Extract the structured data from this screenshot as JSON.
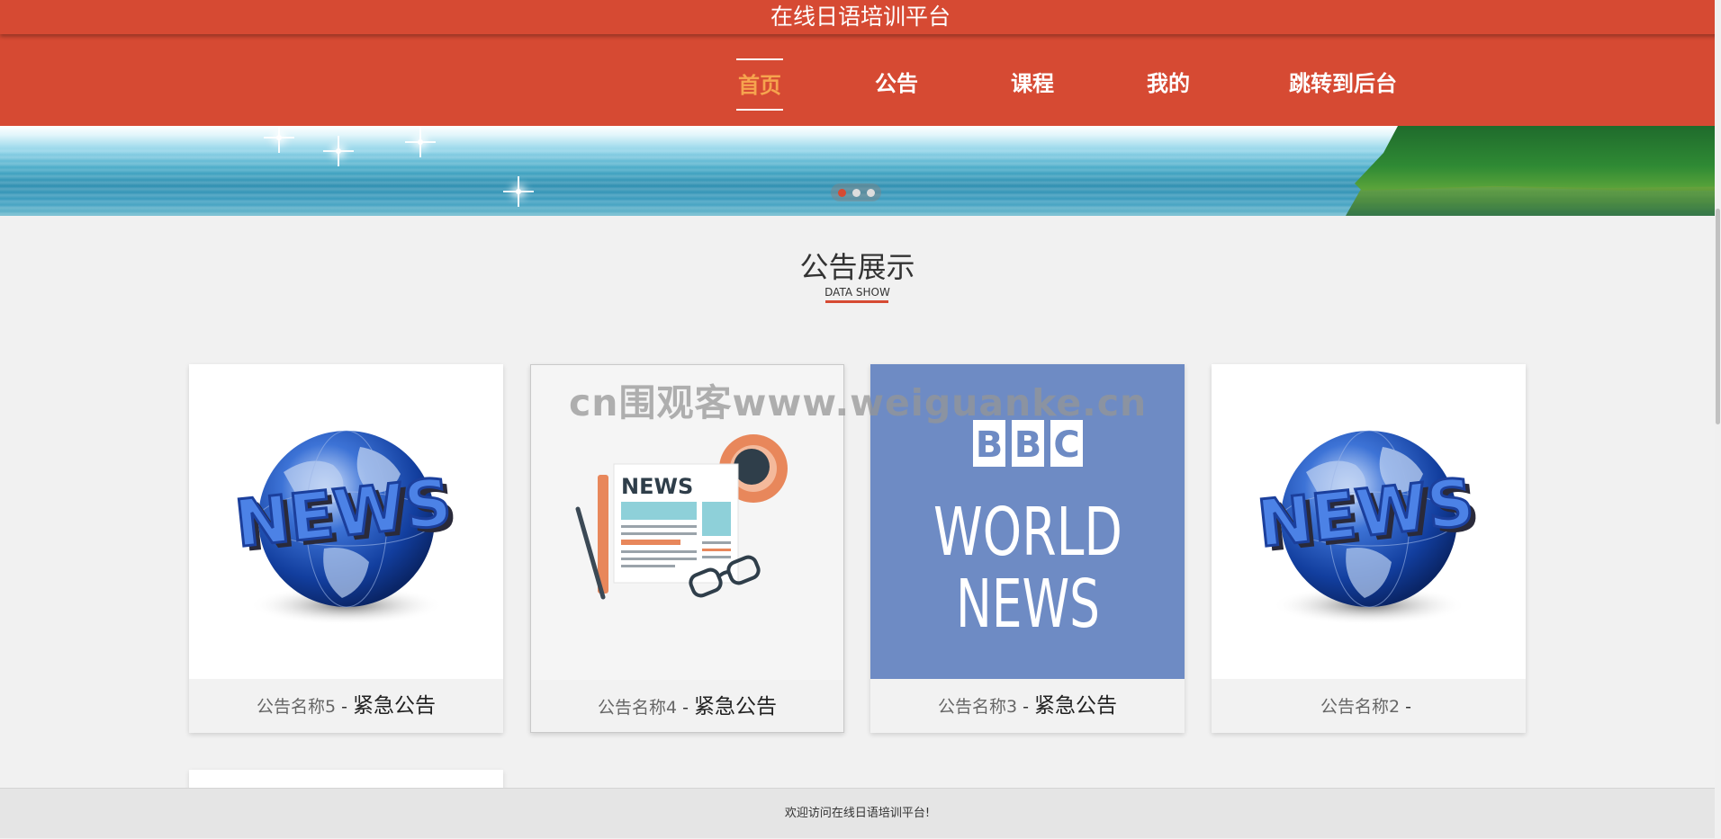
{
  "header": {
    "site_title": "在线日语培训平台"
  },
  "nav": {
    "items": [
      {
        "label": "首页",
        "active": true
      },
      {
        "label": "公告",
        "active": false
      },
      {
        "label": "课程",
        "active": false
      },
      {
        "label": "我的",
        "active": false
      },
      {
        "label": "跳转到后台",
        "active": false
      }
    ]
  },
  "banner": {
    "slide_count": 3,
    "active_slide": 1
  },
  "section": {
    "title": "公告展示",
    "subtitle": "DATA SHOW"
  },
  "cards": [
    {
      "name": "公告名称5",
      "separator": "-",
      "type": "紧急公告",
      "image_icon": "news-globe-image"
    },
    {
      "name": "公告名称4",
      "separator": "-",
      "type": "紧急公告",
      "image_icon": "newspaper-coffee-image"
    },
    {
      "name": "公告名称3",
      "separator": "-",
      "type": "紧急公告",
      "image_icon": "bbc-world-news-image",
      "image_text": {
        "brand": [
          "B",
          "B",
          "C"
        ],
        "line1": "WORLD",
        "line2": "NEWS"
      }
    },
    {
      "name": "公告名称2",
      "separator": "-",
      "type": "",
      "image_icon": "news-globe-image"
    }
  ],
  "images": {
    "globe_text": "NEWS",
    "newspaper_text": "NEWS"
  },
  "watermark": "cn围观客www.weiguanke.cn",
  "footer": {
    "text": "欢迎访问在线日语培训平台!"
  },
  "colors": {
    "brand": "#d64a33",
    "nav_active": "#f6a44e",
    "bbc_bg": "#6e8bc4",
    "page_bg": "#f1f1f1"
  }
}
